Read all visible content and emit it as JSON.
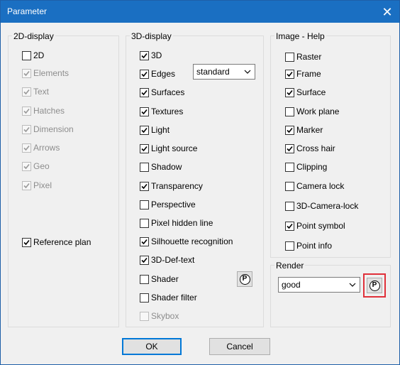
{
  "window": {
    "title": "Parameter",
    "close_glyph": "✕"
  },
  "groups": {
    "display2d": {
      "title": "2D-display",
      "items": [
        {
          "label": "2D",
          "checked": false,
          "disabled": false
        },
        {
          "label": "Elements",
          "checked": true,
          "disabled": true
        },
        {
          "label": "Text",
          "checked": true,
          "disabled": true
        },
        {
          "label": "Hatches",
          "checked": true,
          "disabled": true
        },
        {
          "label": "Dimension",
          "checked": true,
          "disabled": true
        },
        {
          "label": "Arrows",
          "checked": true,
          "disabled": true
        },
        {
          "label": "Geo",
          "checked": true,
          "disabled": true
        },
        {
          "label": "Pixel",
          "checked": true,
          "disabled": true
        },
        {
          "label": "Reference plan",
          "checked": true,
          "disabled": false
        }
      ]
    },
    "display3d": {
      "title": "3D-display",
      "items": [
        {
          "label": "3D",
          "checked": true,
          "disabled": false
        },
        {
          "label": "Edges",
          "checked": true,
          "disabled": false
        },
        {
          "label": "Surfaces",
          "checked": true,
          "disabled": false
        },
        {
          "label": "Textures",
          "checked": true,
          "disabled": false
        },
        {
          "label": "Light",
          "checked": true,
          "disabled": false
        },
        {
          "label": "Light source",
          "checked": true,
          "disabled": false
        },
        {
          "label": "Shadow",
          "checked": false,
          "disabled": false
        },
        {
          "label": "Transparency",
          "checked": true,
          "disabled": false
        },
        {
          "label": "Perspective",
          "checked": false,
          "disabled": false
        },
        {
          "label": "Pixel hidden line",
          "checked": false,
          "disabled": false
        },
        {
          "label": "Silhouette recognition",
          "checked": true,
          "disabled": false
        },
        {
          "label": "3D-Def-text",
          "checked": true,
          "disabled": false
        },
        {
          "label": "Shader",
          "checked": false,
          "disabled": false
        },
        {
          "label": "Shader filter",
          "checked": false,
          "disabled": false
        },
        {
          "label": "Skybox",
          "checked": false,
          "disabled": true
        }
      ],
      "edges_combo": {
        "value": "standard"
      },
      "shader_button": {
        "glyph": "P"
      }
    },
    "image_help": {
      "title": "Image - Help",
      "items": [
        {
          "label": "Raster",
          "checked": false,
          "disabled": false
        },
        {
          "label": "Frame",
          "checked": true,
          "disabled": false
        },
        {
          "label": "Surface",
          "checked": true,
          "disabled": false
        },
        {
          "label": "Work plane",
          "checked": false,
          "disabled": false
        },
        {
          "label": "Marker",
          "checked": true,
          "disabled": false
        },
        {
          "label": "Cross hair",
          "checked": true,
          "disabled": false
        },
        {
          "label": "Clipping",
          "checked": false,
          "disabled": false
        },
        {
          "label": "Camera lock",
          "checked": false,
          "disabled": false
        },
        {
          "label": "3D-Camera-lock",
          "checked": false,
          "disabled": false
        },
        {
          "label": "Point symbol",
          "checked": true,
          "disabled": false
        },
        {
          "label": "Point info",
          "checked": false,
          "disabled": false
        }
      ]
    },
    "render": {
      "title": "Render",
      "combo": {
        "value": "good"
      },
      "button": {
        "glyph": "P",
        "highlight_color": "#e0303a"
      }
    }
  },
  "buttons": {
    "ok": "OK",
    "cancel": "Cancel"
  }
}
